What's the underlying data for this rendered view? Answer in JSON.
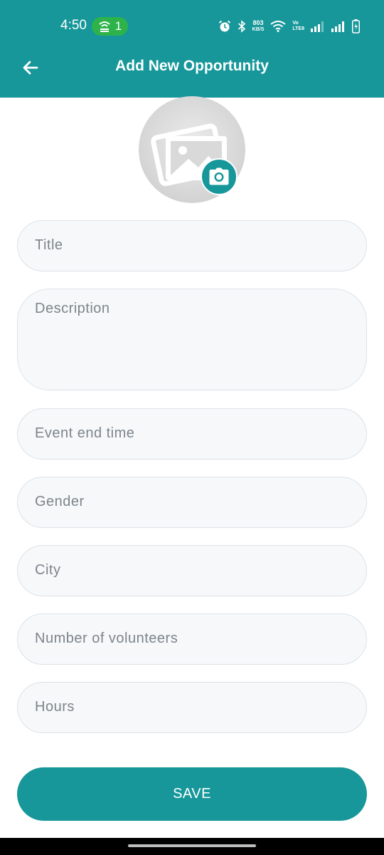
{
  "status_bar": {
    "time": "4:50",
    "hotspot_count": "1",
    "net_speed_value": "803",
    "net_speed_unit": "KB/S",
    "volte_top": "Vo",
    "volte_bottom": "LTE8",
    "icons": [
      "alarm-icon",
      "bluetooth-icon",
      "wifi-icon",
      "signal-icon",
      "signal-icon",
      "battery-icon"
    ]
  },
  "header": {
    "title": "Add New Opportunity",
    "back_icon": "arrow-left-icon"
  },
  "image_picker": {
    "placeholder_icon": "image-gallery-icon",
    "camera_icon": "camera-icon"
  },
  "form": {
    "title_placeholder": "Title",
    "description_placeholder": "Description",
    "event_end_time_placeholder": "Event end time",
    "gender_placeholder": "Gender",
    "city_placeholder": "City",
    "volunteers_placeholder": "Number of volunteers",
    "hours_placeholder": "Hours"
  },
  "actions": {
    "save_label": "SAVE"
  },
  "colors": {
    "primary": "#17979a",
    "hotspot": "#2db34a",
    "field_bg": "#f6f8fa",
    "field_border": "#dde3e7",
    "placeholder_text": "#7d858b"
  }
}
